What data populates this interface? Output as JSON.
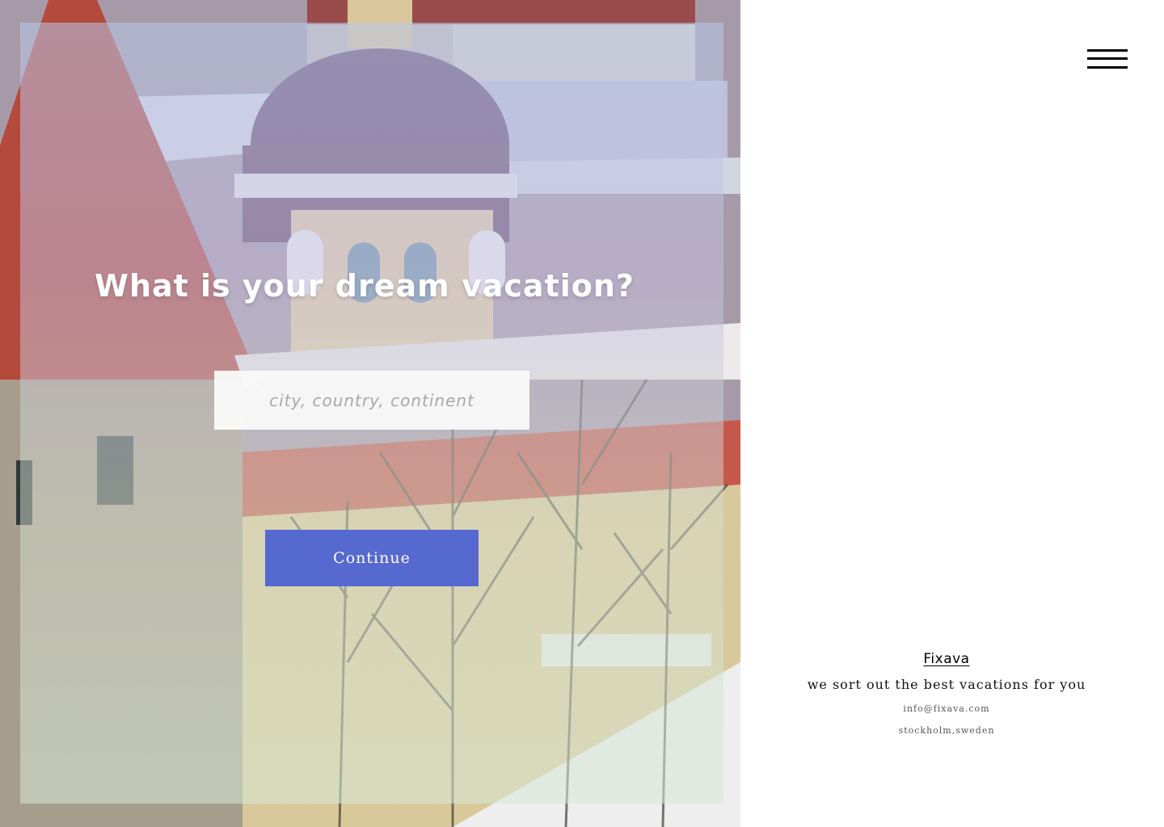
{
  "hero": {
    "headline": "What is your dream vacation?",
    "search": {
      "placeholder": "city, country, continent",
      "value": ""
    },
    "continue_label": "Continue",
    "accent_color": "#5669d1"
  },
  "header": {
    "menu_icon": "hamburger-menu-icon"
  },
  "footer": {
    "brand": "Fixava",
    "tagline": "we sort out the best vacations for you",
    "email": "info@fixava.com",
    "location": "stockholm,sweden"
  }
}
